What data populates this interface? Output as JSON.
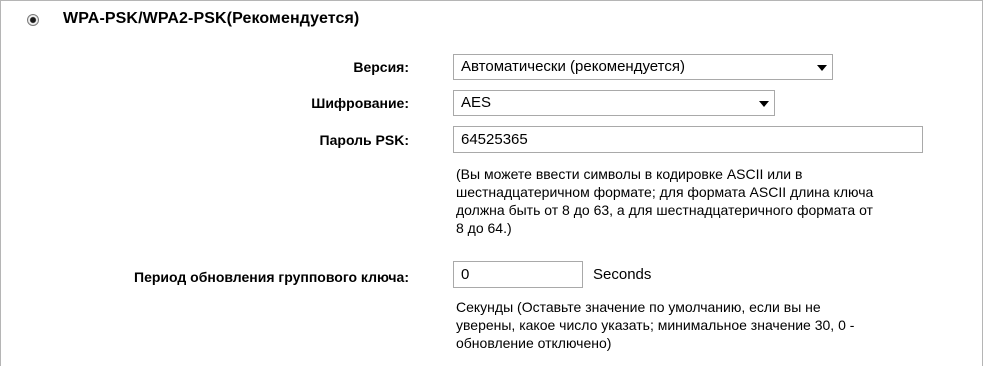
{
  "security": {
    "mode_label": "WPA-PSK/WPA2-PSK(Рекомендуется)",
    "mode_selected": true
  },
  "version": {
    "label": "Версия:",
    "value": "Автоматически (рекомендуется)"
  },
  "encryption": {
    "label": "Шифрование:",
    "value": "AES"
  },
  "psk_password": {
    "label": "Пароль PSK:",
    "value": "64525365",
    "help_lines": [
      "(Вы можете ввести символы в кодировке ASCII или в",
      "шестнадцатеричном формате; для формата ASCII длина ключа",
      "должна быть от 8 до 63, а для шестнадцатеричного формата от",
      "8 до 64.)"
    ]
  },
  "group_key_period": {
    "label": "Период обновления группового ключа:",
    "value": "0",
    "units": "Seconds",
    "help_lines": [
      "Секунды (Оставьте значение по умолчанию, если вы не",
      "уверены, какое число указать; минимальное значение 30, 0 -",
      "обновление отключено)"
    ]
  }
}
